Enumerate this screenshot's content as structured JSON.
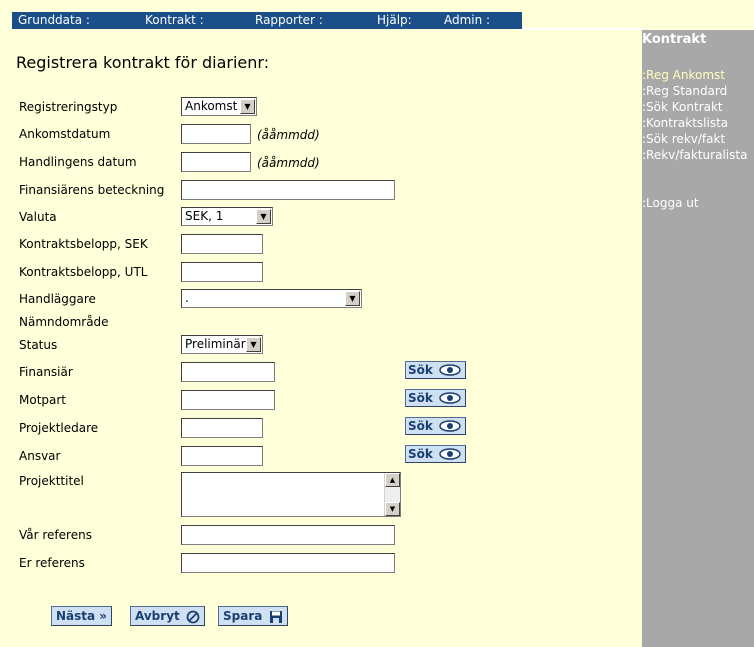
{
  "topnav": [
    {
      "label": "Grunddata :"
    },
    {
      "label": "Kontrakt :"
    },
    {
      "label": "Rapporter :"
    },
    {
      "label": "Hjälp:"
    },
    {
      "label": "Admin :"
    }
  ],
  "sidebar": {
    "title": "Kontrakt",
    "items": [
      {
        "label": ":Reg Ankomst"
      },
      {
        "label": ":Reg Standard"
      },
      {
        "label": ":Sök Kontrakt"
      },
      {
        "label": ":Kontraktslista"
      },
      {
        "label": ":Sök rekv/fakt"
      },
      {
        "label": ":Rekv/fakturalista"
      }
    ],
    "logout": ":Logga ut"
  },
  "form": {
    "title": "Registrera kontrakt för diarienr:",
    "date_hint": "(ååmmdd)",
    "labels": {
      "registreringstyp": "Registreringstyp",
      "ankomstdatum": "Ankomstdatum",
      "handlingens_datum": "Handlingens datum",
      "finansiarens_beteckning": "Finansiärens beteckning",
      "valuta": "Valuta",
      "belopp_sek": "Kontraktsbelopp, SEK",
      "belopp_utl": "Kontraktsbelopp, UTL",
      "handlaggare": "Handläggare",
      "namndomrade": "Nämndområde",
      "status": "Status",
      "finansiar": "Finansiär",
      "motpart": "Motpart",
      "projektledare": "Projektledare",
      "ansvar": "Ansvar",
      "projekttitel": "Projekttitel",
      "var_referens": "Vår referens",
      "er_referens": "Er referens"
    },
    "values": {
      "registreringstyp": "Ankomst",
      "valuta": "SEK, 1",
      "handlaggare": ".",
      "status": "Preliminär"
    },
    "search_label": "Sök"
  },
  "actions": {
    "next": "Nästa »",
    "cancel": "Avbryt",
    "save": "Spara"
  }
}
